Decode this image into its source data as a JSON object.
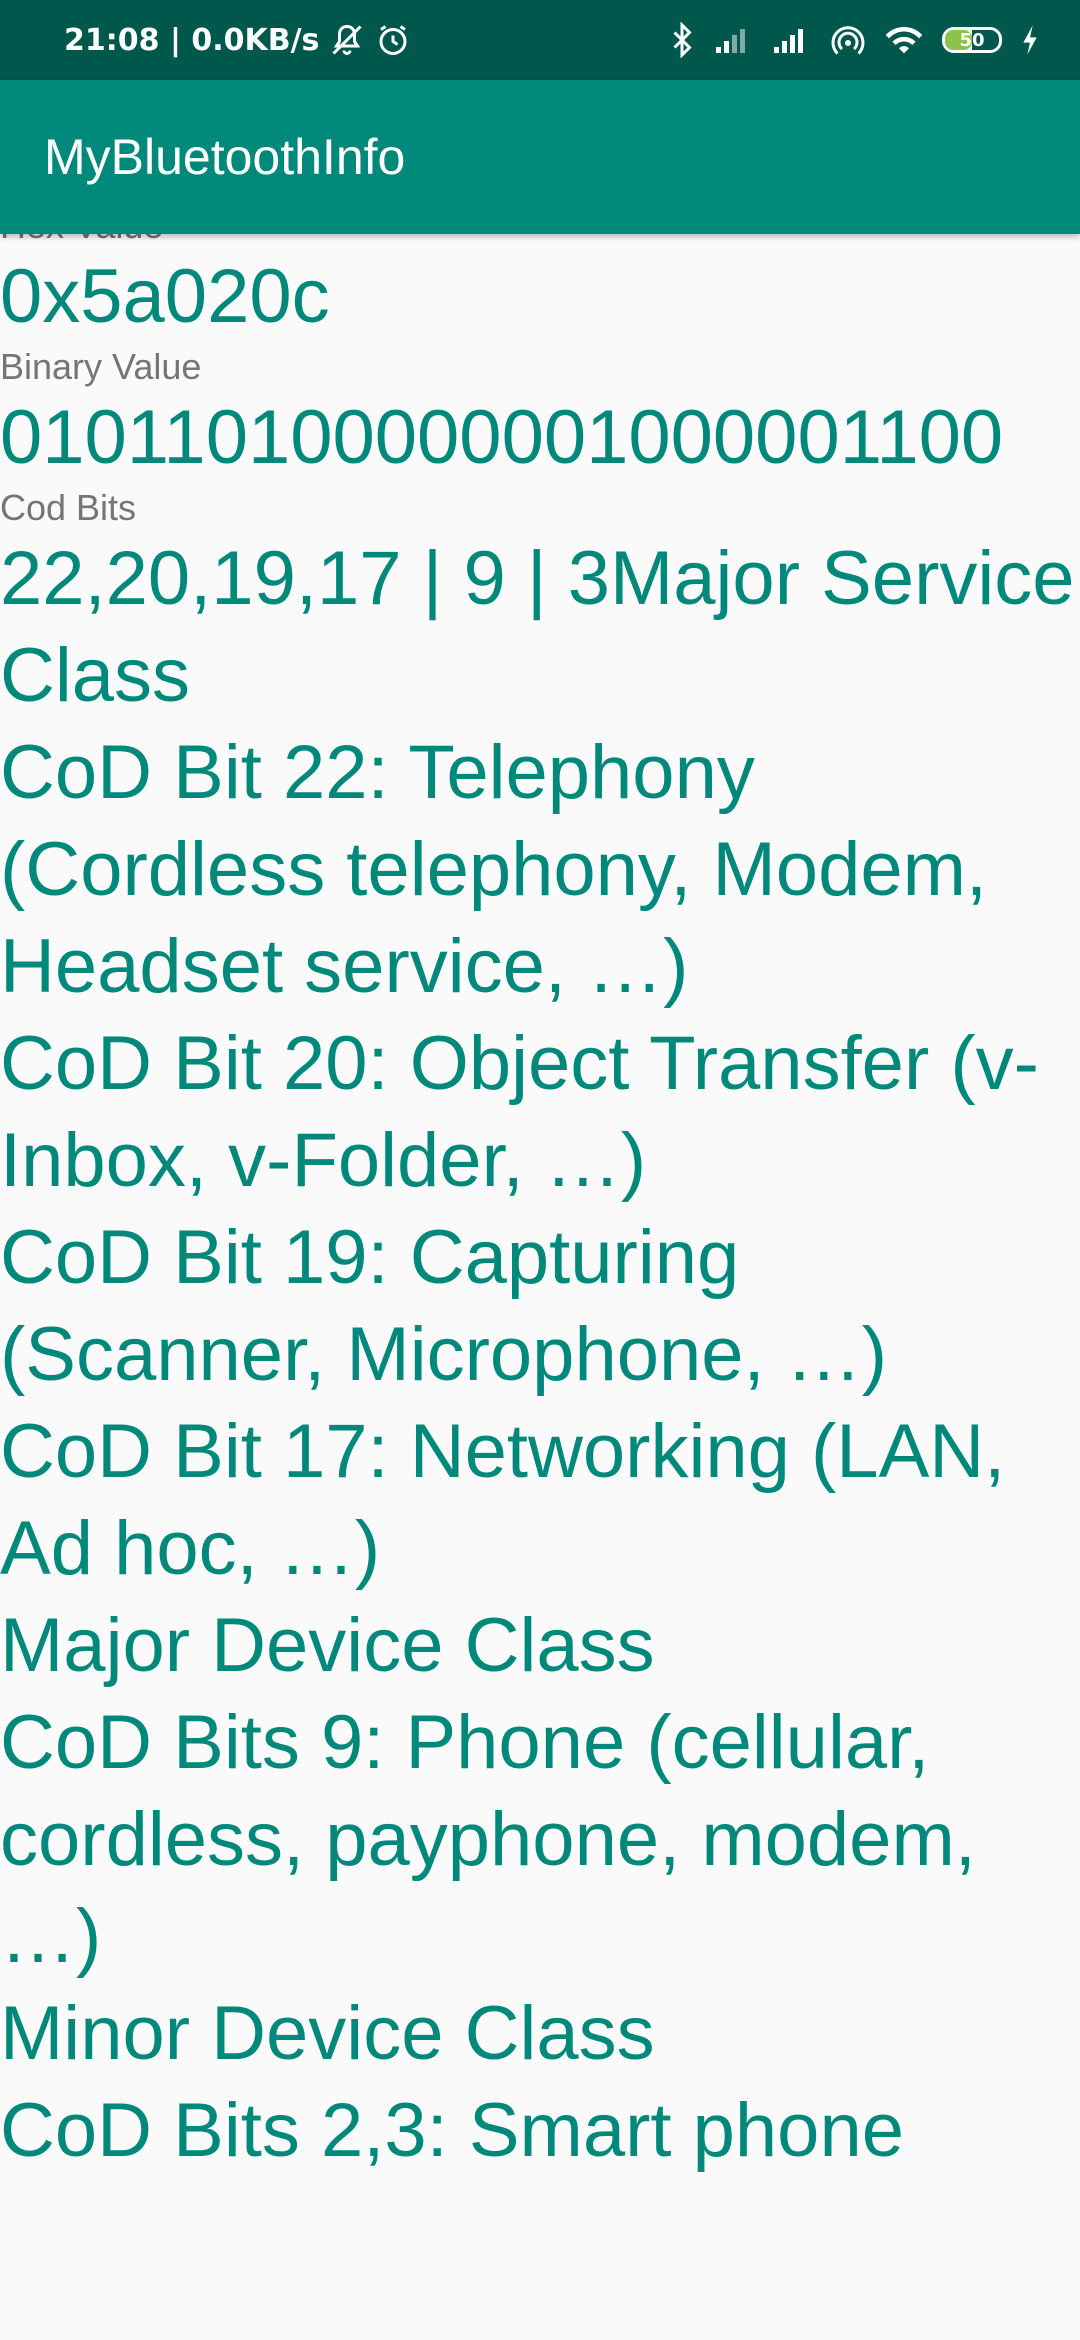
{
  "status_bar": {
    "time_speed": "21:08 | 0.0KB/s",
    "icons": [
      "mute-bell-icon",
      "alarm-icon",
      "bluetooth-icon",
      "signal-1-icon",
      "signal-2-icon",
      "hotspot-icon",
      "wifi-icon",
      "battery-icon",
      "charging-icon"
    ],
    "battery_level": "50",
    "colors": {
      "background": "#00574b",
      "battery_fill": "#8bc34a"
    }
  },
  "app_bar": {
    "title": "MyBluetoothInfo",
    "color": "#00897b"
  },
  "content": {
    "hex_label": "Hex Value",
    "hex_value": "0x5a020c",
    "binary_label": "Binary Value",
    "binary_value": "010110100000001000001100",
    "cod_bits_label": "Cod Bits",
    "cod_bits_value": "22,20,19,17 | 9 | 3Major Service Class",
    "lines": [
      "CoD Bit 22: Telephony (Cordless telephony, Modem, Headset service, …)",
      "CoD Bit 20: Object Transfer (v-Inbox, v-Folder, …)",
      "CoD Bit 19: Capturing (Scanner, Microphone, …)",
      "CoD Bit 17: Networking (LAN, Ad hoc, …)",
      "Major Device Class",
      "CoD Bits 9: Phone (cellular, cordless, payphone, modem, …)",
      "Minor Device Class",
      "CoD Bits 2,3: Smart phone"
    ],
    "colors": {
      "value": "#00897b",
      "label": "#757575"
    }
  }
}
